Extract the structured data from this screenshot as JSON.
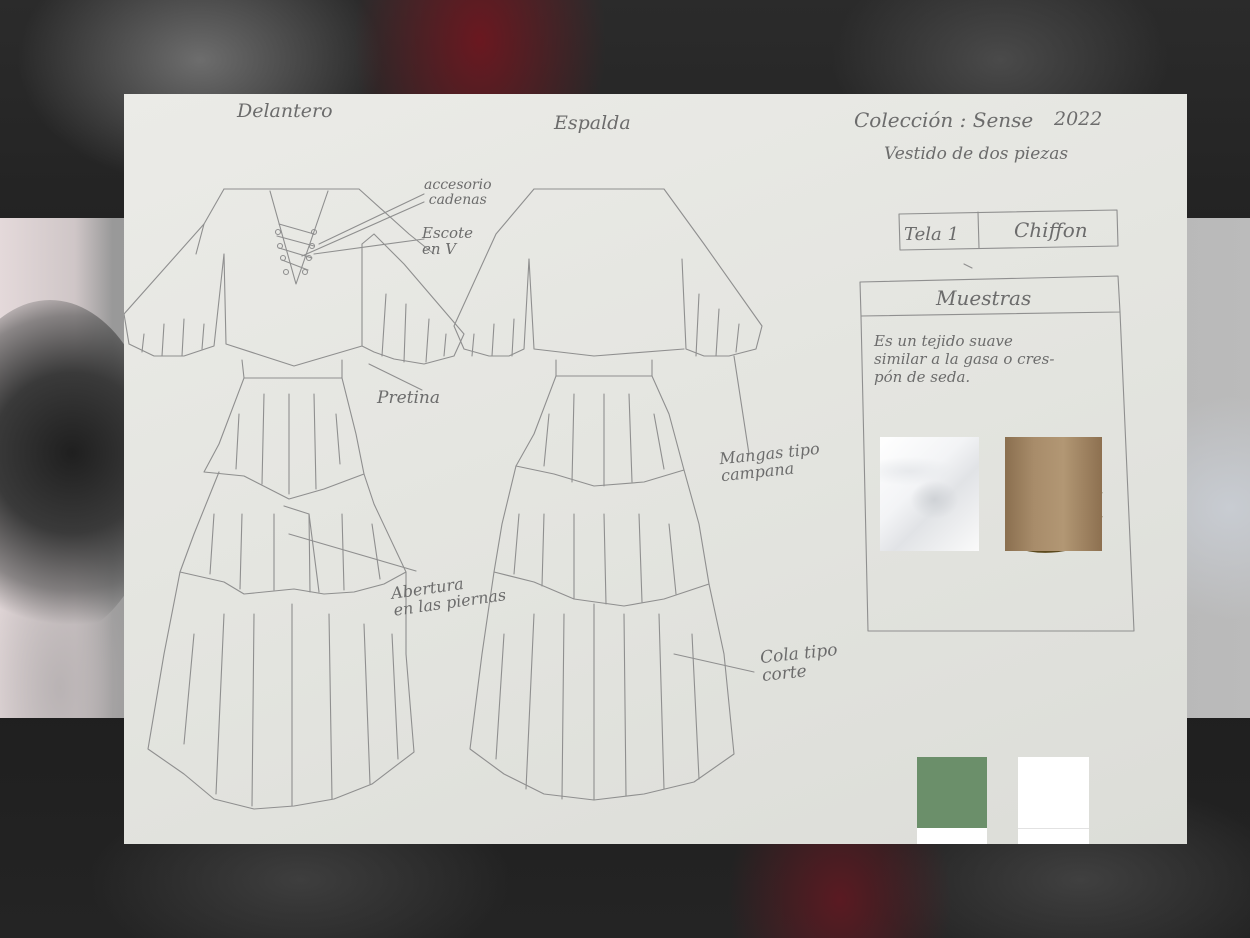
{
  "sheet": {
    "front_label": "Delantero",
    "back_label": "Espalda",
    "collection_label": "Colección : Sense",
    "year": "2022",
    "subtitle": "Vestido de dos piezas"
  },
  "annotations": {
    "accessory": "accesorio\ncadenas",
    "neckline": "Escote\nen V",
    "waistband": "Pretina",
    "sleeves": "Mangas tipo\ncampana",
    "slit": "Abertura\nen las piernas",
    "train": "Cola tipo\ncorte"
  },
  "fabric_spec": {
    "label": "Tela 1",
    "value": "Chiffon"
  },
  "samples_panel": {
    "title": "Muestras",
    "description": "Es un tejido suave\nsimilar a la gasa o cres-\npón de seda."
  },
  "colors": {
    "pencil": "#8a8a8a",
    "sheet": "#e6e6e1",
    "swatch_green": "#6b8f6a",
    "swatch_white": "#ffffff",
    "chain_gold": "#5c4a1e"
  }
}
